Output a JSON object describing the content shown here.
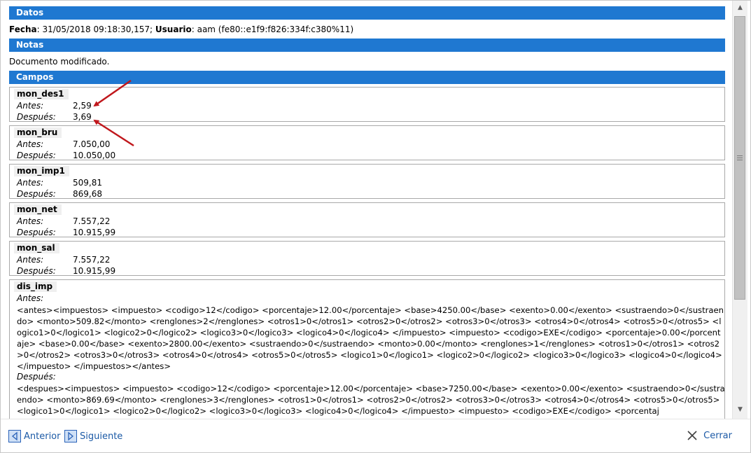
{
  "sections": {
    "datos": "Datos",
    "notas": "Notas",
    "campos": "Campos"
  },
  "datos": {
    "fecha_label": "Fecha",
    "fecha_value": ": 31/05/2018 09:18:30,157; ",
    "usuario_label": "Usuario",
    "usuario_value": ": aam (fe80::e1f9:f826:334f:c380%11)"
  },
  "notas": {
    "text": "Documento modificado."
  },
  "labels": {
    "antes": "Antes:",
    "despues": "Después:"
  },
  "fields": [
    {
      "name": "mon_des1",
      "antes": "2,59",
      "despues": "3,69"
    },
    {
      "name": "mon_bru",
      "antes": "7.050,00",
      "despues": "10.050,00"
    },
    {
      "name": "mon_imp1",
      "antes": "509,81",
      "despues": "869,68"
    },
    {
      "name": "mon_net",
      "antes": "7.557,22",
      "despues": "10.915,99"
    },
    {
      "name": "mon_sal",
      "antes": "7.557,22",
      "despues": "10.915,99"
    }
  ],
  "dis_imp": {
    "name": "dis_imp",
    "antes": "<antes><impuestos> <impuesto> <codigo>12</codigo> <porcentaje>12.00</porcentaje> <base>4250.00</base> <exento>0.00</exento> <sustraendo>0</sustraendo> <monto>509.82</monto> <renglones>2</renglones> <otros1>0</otros1> <otros2>0</otros2> <otros3>0</otros3> <otros4>0</otros4> <otros5>0</otros5> <logico1>0</logico1> <logico2>0</logico2> <logico3>0</logico3> <logico4>0</logico4> </impuesto> <impuesto> <codigo>EXE</codigo> <porcentaje>0.00</porcentaje> <base>0.00</base> <exento>2800.00</exento> <sustraendo>0</sustraendo> <monto>0.00</monto> <renglones>1</renglones> <otros1>0</otros1> <otros2>0</otros2> <otros3>0</otros3> <otros4>0</otros4> <otros5>0</otros5> <logico1>0</logico1> <logico2>0</logico2> <logico3>0</logico3> <logico4>0</logico4> </impuesto> </impuestos></antes>",
    "despues": "<despues><impuestos> <impuesto> <codigo>12</codigo> <porcentaje>12.00</porcentaje> <base>7250.00</base> <exento>0.00</exento> <sustraendo>0</sustraendo> <monto>869.69</monto> <renglones>3</renglones> <otros1>0</otros1> <otros2>0</otros2> <otros3>0</otros3> <otros4>0</otros4> <otros5>0</otros5> <logico1>0</logico1> <logico2>0</logico2> <logico3>0</logico3> <logico4>0</logico4> </impuesto> <impuesto> <codigo>EXE</codigo> <porcentaj"
  },
  "footer": {
    "anterior": "Anterior",
    "siguiente": "Siguiente",
    "cerrar": "Cerrar"
  },
  "colors": {
    "header_bg": "#1f78d1",
    "annotation_arrow": "#c0171c",
    "link": "#1c5aa6"
  },
  "icons": [
    "arrow-left-icon",
    "arrow-right-icon",
    "close-x-icon",
    "scroll-up-icon",
    "scroll-down-icon"
  ]
}
